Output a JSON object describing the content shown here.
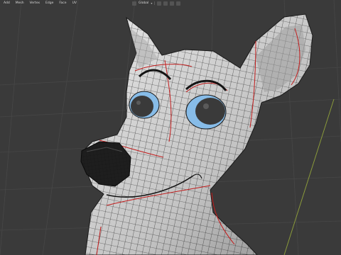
{
  "app": {
    "header_menu": [
      "Add",
      "Mesh",
      "Vertex",
      "Edge",
      "Face",
      "UV"
    ],
    "transform_orientation": "Global"
  },
  "viewport": {
    "subject": "3D wolf character head mesh in edit mode (wireframe overlay)",
    "colors": {
      "background": "#3a3a3a",
      "grid": "#474747",
      "mesh_surface": "#c9c9c9",
      "wireframe": "#1a1a1a",
      "seam_edges": "#c21d1d",
      "eye_iris": "#87bce8",
      "pupil": "#3a3a3a",
      "nose": "#1e1e1e",
      "axis_line": "#8a9a3a"
    }
  }
}
